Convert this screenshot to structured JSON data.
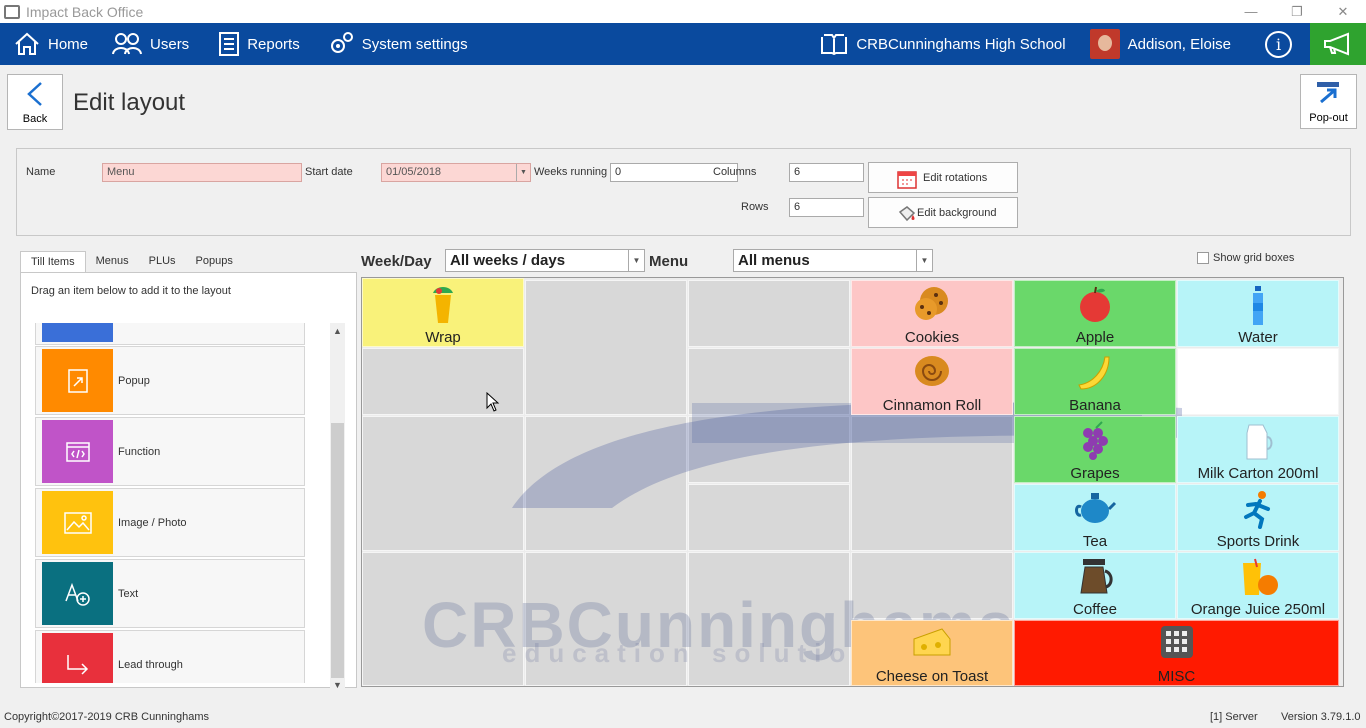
{
  "window": {
    "title": "Impact Back Office",
    "minimize": "—",
    "restore": "❐",
    "close": "✕"
  },
  "nav": {
    "home": "Home",
    "users": "Users",
    "reports": "Reports",
    "system_settings": "System settings",
    "school": "CRBCunninghams High School",
    "user": "Addison, Eloise",
    "info": "i"
  },
  "header": {
    "back": "Back",
    "title": "Edit layout",
    "popout": "Pop-out"
  },
  "form": {
    "name_label": "Name",
    "name_value": "Menu",
    "start_label": "Start date",
    "start_value": "01/05/2018",
    "weeks_label": "Weeks running",
    "weeks_value": "0",
    "columns_label": "Columns",
    "columns_value": "6",
    "rows_label": "Rows",
    "rows_value": "6",
    "edit_rotations": "Edit rotations",
    "edit_background": "Edit background"
  },
  "left": {
    "tabs": [
      "Till Items",
      "Menus",
      "PLUs",
      "Popups"
    ],
    "hint": "Drag an item below to add it to the layout",
    "items": [
      {
        "name": "Popup",
        "color": "#ff8a00",
        "icon": "popup-icon"
      },
      {
        "name": "Function",
        "color": "#c054c8",
        "icon": "function-icon"
      },
      {
        "name": "Image / Photo",
        "color": "#ffc20e",
        "icon": "image-icon"
      },
      {
        "name": "Text",
        "color": "#0a7080",
        "icon": "text-icon"
      },
      {
        "name": "Lead through",
        "color": "#e8303c",
        "icon": "lead-through-icon"
      }
    ],
    "partial_item_color": "#3a6fd8"
  },
  "filters": {
    "weekday_label": "Week/Day",
    "weekday_value": "All weeks / days",
    "menu_label": "Menu",
    "menu_value": "All menus",
    "grid_boxes": "Show grid boxes"
  },
  "watermark": {
    "line1": "CRBCunninghams",
    "line2": "education solutions"
  },
  "tiles": {
    "wrap": "Wrap",
    "cookies": "Cookies",
    "apple": "Apple",
    "water": "Water",
    "cinnamon_roll": "Cinnamon Roll",
    "banana": "Banana",
    "grapes": "Grapes",
    "milk": "Milk Carton 200ml",
    "tea": "Tea",
    "sports_drink": "Sports Drink",
    "coffee": "Coffee",
    "orange_juice": "Orange Juice 250ml",
    "cheese_toast": "Cheese on Toast",
    "misc": "MISC"
  },
  "colors": {
    "yellow": "#f9f27a",
    "pink": "#fdc6c6",
    "green": "#6ad86a",
    "cyan": "#b7f4f8",
    "orange": "#fdc47a",
    "red": "#ff1a00",
    "nav": "#0a4a9e"
  },
  "footer": {
    "copyright": "Copyright©2017-2019 CRB Cunninghams",
    "server": "[1] Server",
    "version": "Version 3.79.1.0"
  }
}
